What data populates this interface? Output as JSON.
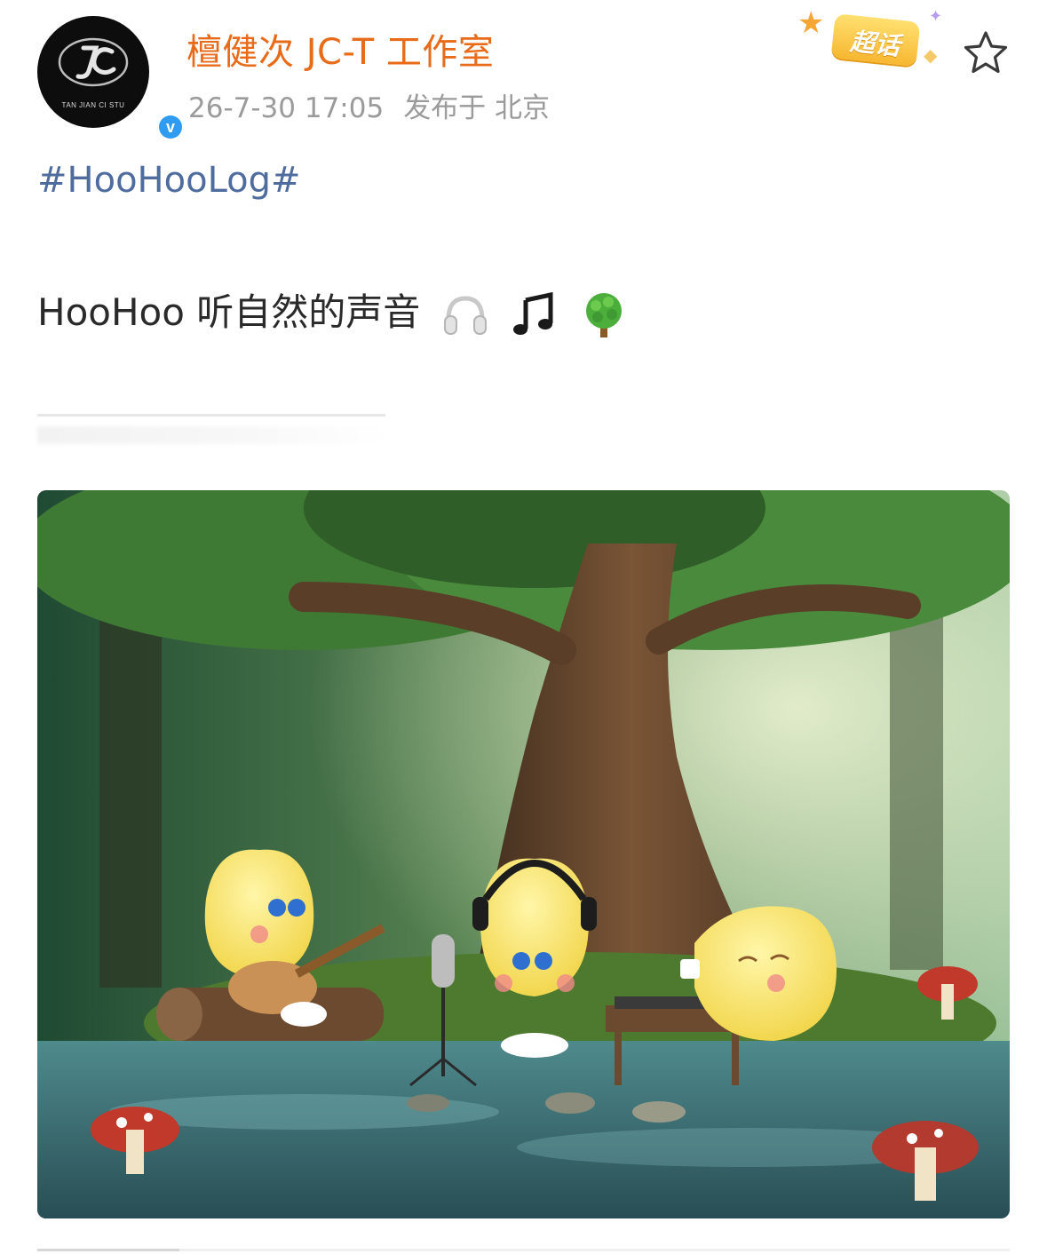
{
  "post": {
    "author": {
      "name": "檀健次 JC-T 工作室",
      "avatar_text": "TAN JIAN CI STU",
      "verified_icon": "verified-badge-icon",
      "verified_mark": "v"
    },
    "timestamp": "26-7-30 17:05",
    "location_label": "发布于 北京",
    "chaohua_badge": "超话",
    "favorite_icon": "star-outline-icon",
    "hashtag": "#HooHooLog#",
    "text": "HooHoo 听自然的声音",
    "emojis": [
      "headphones-icon",
      "music-note-icon",
      "tree-icon"
    ],
    "image": {
      "description_icon": "forest-illustration-image"
    }
  },
  "colors": {
    "author_name": "#e86b1a",
    "meta_text": "#9b9b9b",
    "hashtag": "#4f6c9e",
    "body_text": "#2a2a2a",
    "verified": "#2f9cf2",
    "badge": "#f7b731"
  }
}
